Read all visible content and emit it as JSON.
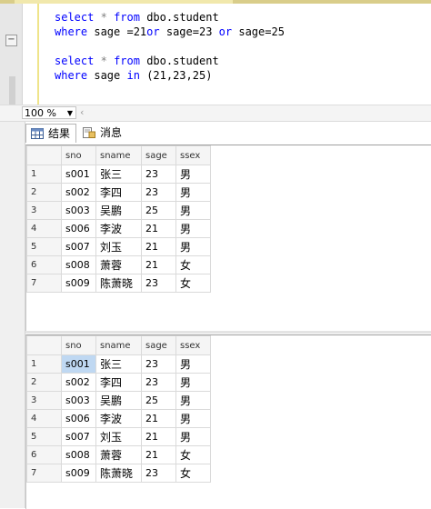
{
  "editor": {
    "lines": [
      {
        "kw1": "select",
        "op": "*",
        "kw2": "from",
        "table": "dbo.student"
      },
      {
        "kw": "where",
        "cond_a": "sage =21",
        "or1": "or",
        "cond_b": "sage=23",
        "or2": "or",
        "cond_c": "sage=25"
      },
      {
        "kw1": "select",
        "op": "*",
        "kw2": "from",
        "table": "dbo.student"
      },
      {
        "kw": "where",
        "field": "sage",
        "in_kw": "in",
        "list": "(21,23,25)"
      }
    ],
    "ruler_toggle": "−"
  },
  "zoom": {
    "value": "100 %",
    "scroll_glyph": "‹"
  },
  "tabs": {
    "results": "结果",
    "messages": "消息"
  },
  "grid": {
    "columns": [
      "sno",
      "sname",
      "sage",
      "ssex"
    ],
    "rows": [
      {
        "n": "1",
        "sno": "s001",
        "sname": "张三",
        "sage": "23",
        "ssex": "男"
      },
      {
        "n": "2",
        "sno": "s002",
        "sname": "李四",
        "sage": "23",
        "ssex": "男"
      },
      {
        "n": "3",
        "sno": "s003",
        "sname": "吴鹏",
        "sage": "25",
        "ssex": "男"
      },
      {
        "n": "4",
        "sno": "s006",
        "sname": "李波",
        "sage": "21",
        "ssex": "男"
      },
      {
        "n": "5",
        "sno": "s007",
        "sname": "刘玉",
        "sage": "21",
        "ssex": "男"
      },
      {
        "n": "6",
        "sno": "s008",
        "sname": "萧蓉",
        "sage": "21",
        "ssex": "女"
      },
      {
        "n": "7",
        "sno": "s009",
        "sname": "陈萧晓",
        "sage": "23",
        "ssex": "女"
      }
    ]
  },
  "colors": {
    "keyword": "#0000ff",
    "selection": "#bfd8f2",
    "margin_bar": "#efe48a"
  }
}
